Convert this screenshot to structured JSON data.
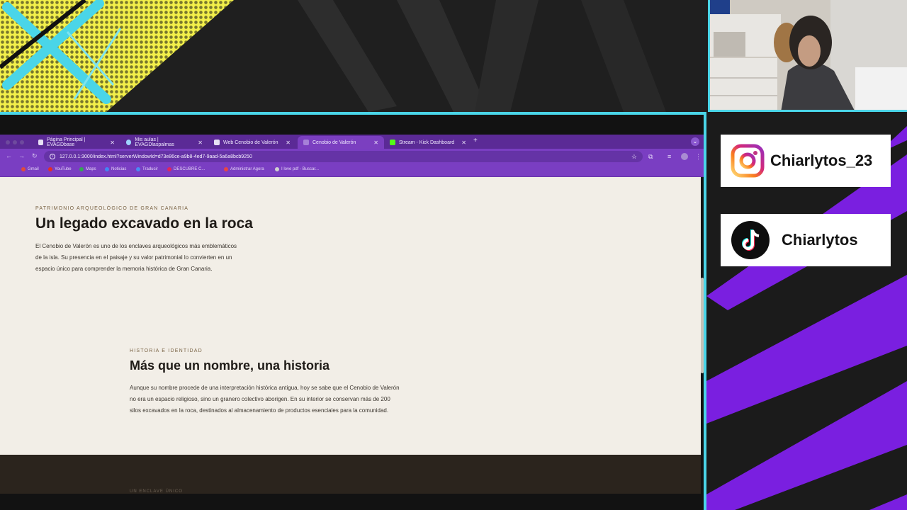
{
  "browser": {
    "tabs": [
      {
        "label": "Página Principal | EVAGDbase",
        "active": false
      },
      {
        "label": "Mis aulas | EVAGDlaspalmas",
        "active": false
      },
      {
        "label": "Web Cenobio de Valerón",
        "active": false
      },
      {
        "label": "Cenobio de Valerón",
        "active": true
      },
      {
        "label": "Stream - Kick Dashboard",
        "active": false
      }
    ],
    "new_tab": "+",
    "url": "127.0.0.1:3000/index.html?serverWindowId=d73e86ce-a9b8-4ed7-9aad-5a6a8bcb9250",
    "bookmarks": [
      {
        "label": "Gmail",
        "color": "#e04b3a"
      },
      {
        "label": "YouTube",
        "color": "#e52d27"
      },
      {
        "label": "Maps",
        "color": "#34a853"
      },
      {
        "label": "Noticias",
        "color": "#4285f4"
      },
      {
        "label": "Traducir",
        "color": "#4a8af4"
      },
      {
        "label": "DESCUBRE C...",
        "color": "#e0245e"
      },
      {
        "label": "Administrar Agora",
        "color": "#e84545"
      },
      {
        "label": "I love pdf - Buscar...",
        "color": "#d0d0d0"
      }
    ]
  },
  "page": {
    "section1": {
      "eyebrow": "PATRIMONIO ARQUEOLÓGICO DE GRAN CANARIA",
      "title": "Un legado excavado en la roca",
      "lines": [
        "El Cenobio de Valerón es uno de los enclaves arqueológicos más emblemáticos",
        "de la isla. Su presencia en el paisaje y su valor patrimonial lo convierten en un",
        "espacio único para comprender la memoria histórica de Gran Canaria."
      ]
    },
    "section2": {
      "eyebrow": "HISTORIA E IDENTIDAD",
      "title": "Más que un nombre, una historia",
      "lines": [
        "Aunque su nombre procede de una interpretación histórica antigua, hoy se sabe que el Cenobio de Valerón",
        "no era un espacio religioso, sino un granero colectivo aborigen. En su interior se conservan más de 200",
        "silos excavados en la roca, destinados al almacenamiento de productos esenciales para la comunidad."
      ]
    },
    "dark_section_peek": "UN ENCLAVE ÚNICO"
  },
  "socials": {
    "instagram": {
      "handle": "Chiarlytos_23",
      "icon": "instagram-icon"
    },
    "tiktok": {
      "handle": "Chiarlytos",
      "icon": "tiktok-icon"
    }
  },
  "colors": {
    "accent_cyan": "#4ad5e8",
    "browser_purple": "#7a3ec2",
    "stripe_purple": "#7a1fe0",
    "page_bg": "#f2eee7",
    "yellow": "#f2ef4a"
  }
}
